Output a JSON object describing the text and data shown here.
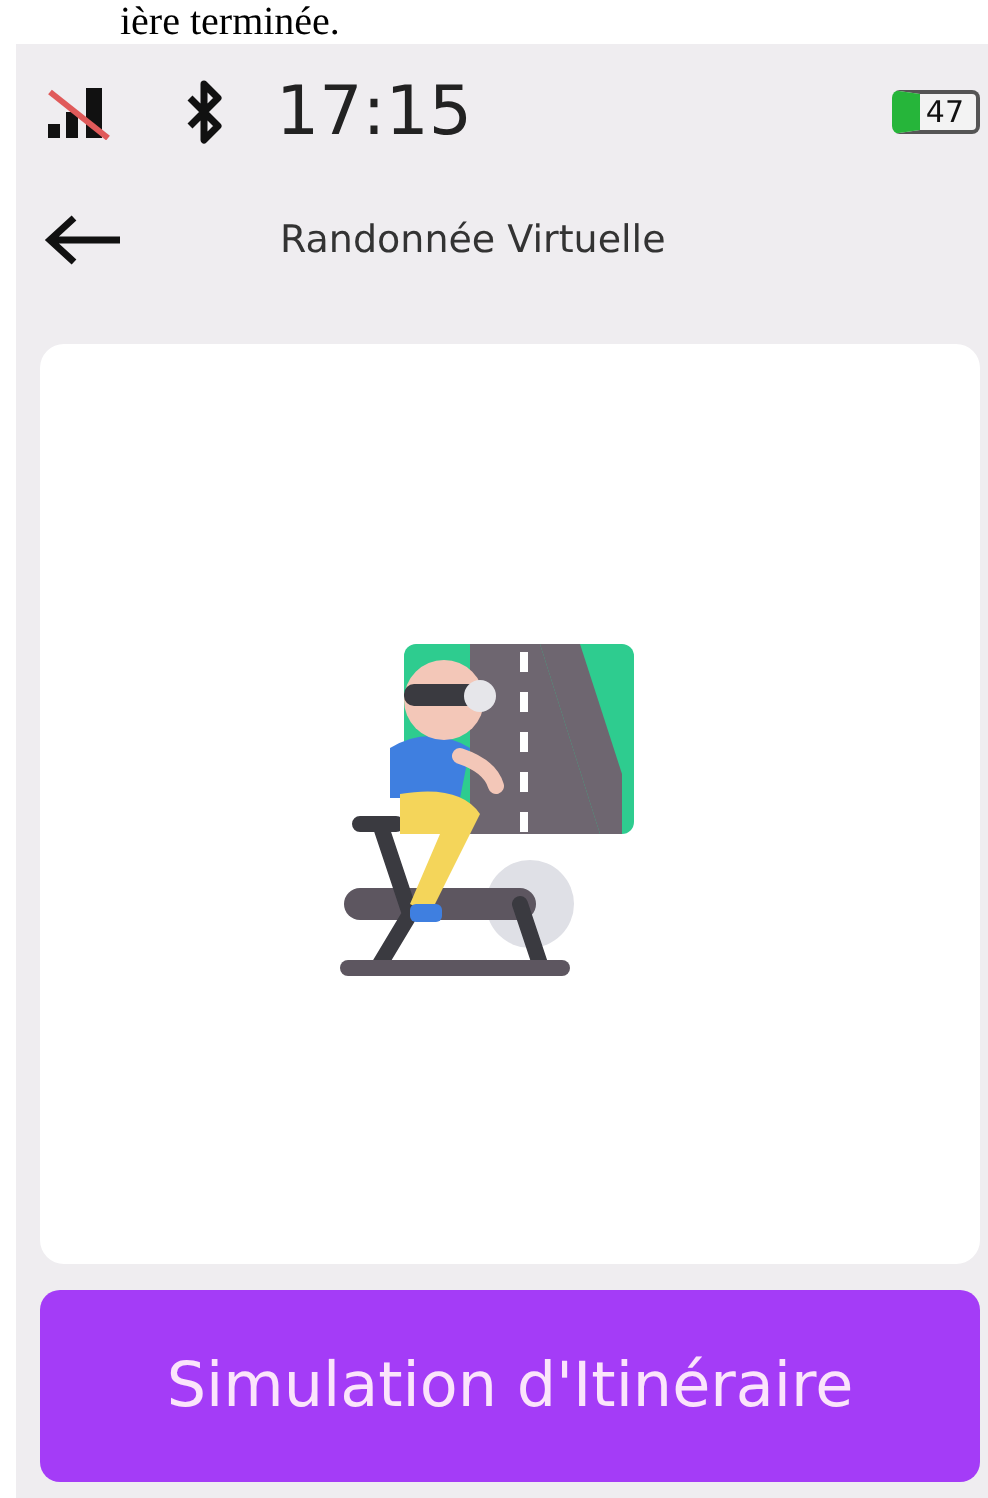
{
  "caption": "ière terminée.",
  "status_bar": {
    "signal_off": true,
    "bluetooth": true,
    "time": "17:15",
    "battery": "47"
  },
  "header": {
    "title": "Randonnée Virtuelle"
  },
  "button": {
    "label": "Simulation d'Itinéraire"
  }
}
